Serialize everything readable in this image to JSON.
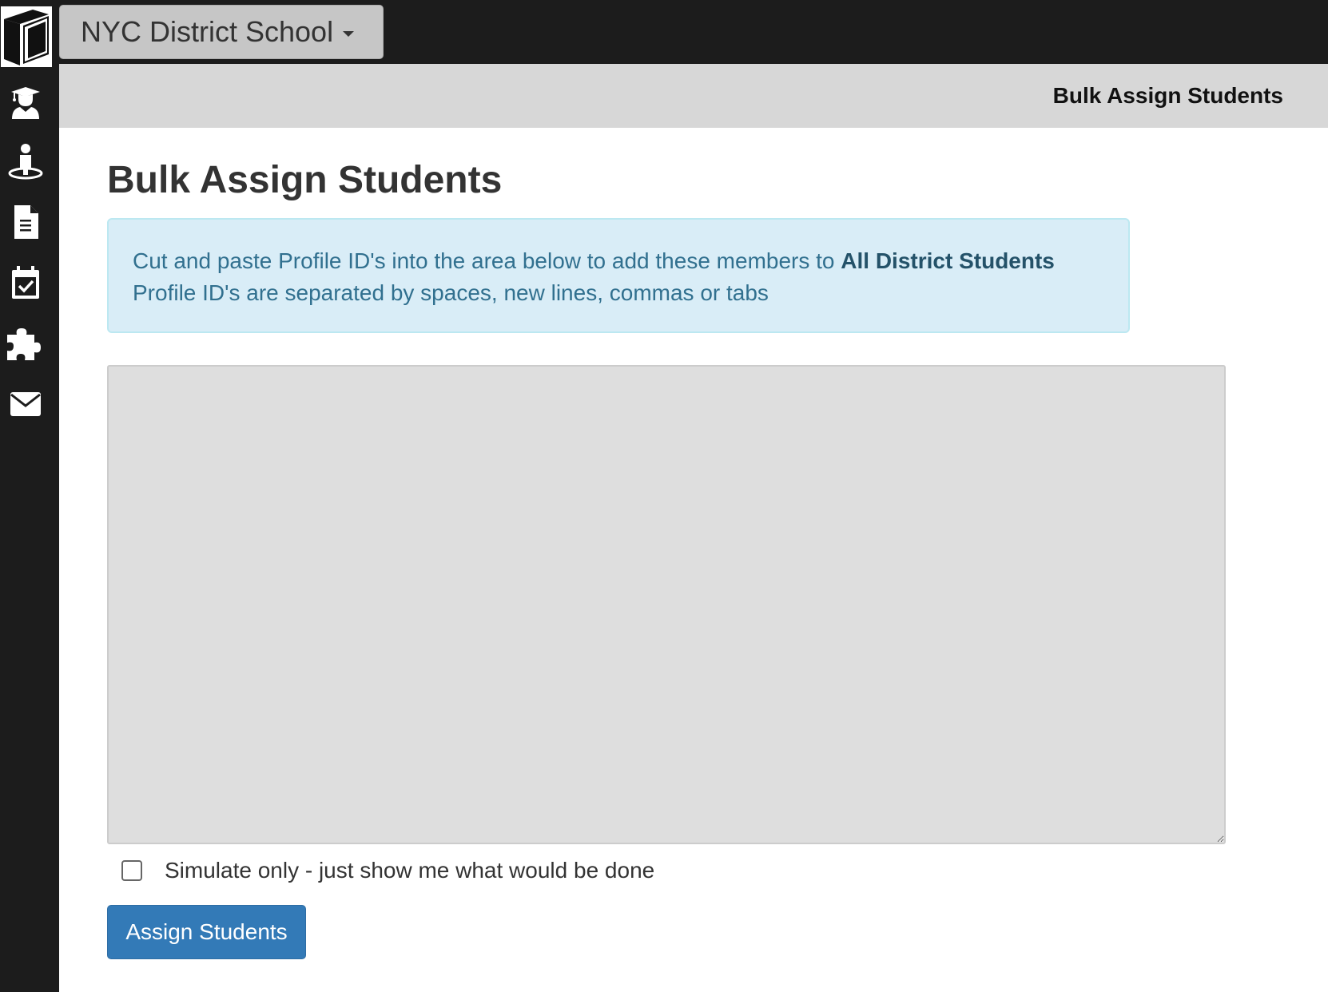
{
  "nav": {
    "school_selector": "NYC District School",
    "icons": [
      "book-logo-icon",
      "graduate-icon",
      "student-icon",
      "document-icon",
      "calendar-check-icon",
      "puzzle-icon",
      "envelope-icon"
    ]
  },
  "breadcrumb": {
    "title": "Bulk Assign Students"
  },
  "main": {
    "title": "Bulk Assign Students",
    "info": {
      "line1_prefix": "Cut and paste Profile ID's into the area below to add these members to ",
      "line1_target": "All District Students",
      "line2": "Profile ID's are separated by spaces, new lines, commas or tabs"
    },
    "ids_input": {
      "value": "",
      "placeholder": ""
    },
    "simulate": {
      "label": "Simulate only - just show me what would be done",
      "checked": false
    },
    "submit_label": "Assign Students"
  },
  "colors": {
    "sidebar_bg": "#1c1c1c",
    "breadbar_bg": "#d7d7d7",
    "info_bg": "#d9edf7",
    "info_text": "#31708f",
    "button_primary": "#337ab7"
  }
}
